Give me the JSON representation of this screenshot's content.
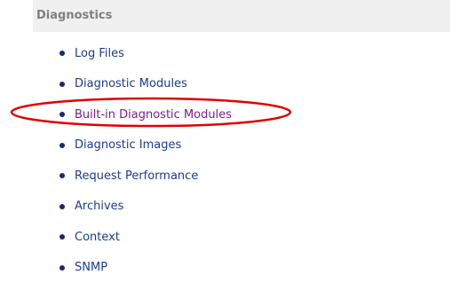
{
  "section": {
    "title": "Diagnostics"
  },
  "links": [
    {
      "label": "Log Files"
    },
    {
      "label": "Diagnostic Modules"
    },
    {
      "label": "Built-in Diagnostic Modules",
      "visited": true,
      "highlighted": true
    },
    {
      "label": "Diagnostic Images"
    },
    {
      "label": "Request Performance"
    },
    {
      "label": "Archives"
    },
    {
      "label": "Context"
    },
    {
      "label": "SNMP"
    }
  ],
  "colors": {
    "header_bg": "#f0f0f0",
    "header_text": "#7f7f7f",
    "link": "#1e3a8a",
    "visited_link": "#7a1e8a",
    "annotation": "#e00000"
  },
  "annotation": {
    "shape": "red-ellipse"
  }
}
